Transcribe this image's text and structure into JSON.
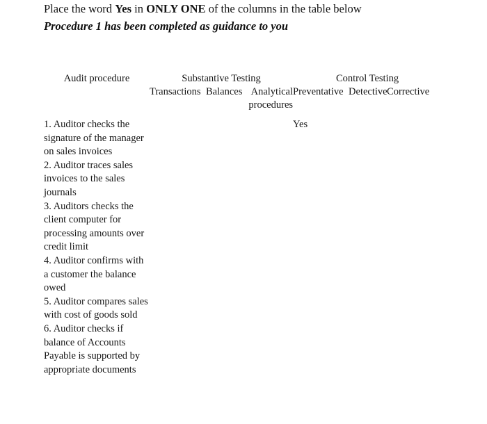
{
  "instructions": {
    "line1_pre": "Place the word ",
    "line1_bold1": "Yes",
    "line1_mid": " in ",
    "line1_bold2": "ONLY ONE",
    "line1_post": " of the columns in the table below",
    "line2": "Procedure 1 has been completed as guidance to you"
  },
  "table": {
    "group_headers": {
      "audit_procedure": "Audit procedure",
      "substantive_testing": "Substantive Testing",
      "control_testing": "Control Testing"
    },
    "sub_headers": {
      "transactions": "Transactions",
      "balances": "Balances",
      "analytical": "Analytical procedures",
      "preventative": "Preventative",
      "detective": "Detective",
      "corrective": "Corrective"
    },
    "rows": [
      {
        "procedure": "1. Auditor checks the signature of the manager on sales invoices",
        "transactions": "",
        "balances": "",
        "analytical": "",
        "preventative": "Yes",
        "detective": "",
        "corrective": ""
      },
      {
        "procedure": "2. Auditor traces sales invoices to the sales journals",
        "transactions": "",
        "balances": "",
        "analytical": "",
        "preventative": "",
        "detective": "",
        "corrective": ""
      },
      {
        "procedure": "3. Auditors checks the client computer for processing amounts over credit limit",
        "transactions": "",
        "balances": "",
        "analytical": "",
        "preventative": "",
        "detective": "",
        "corrective": ""
      },
      {
        "procedure": "4. Auditor confirms with a customer the balance owed",
        "transactions": "",
        "balances": "",
        "analytical": "",
        "preventative": "",
        "detective": "",
        "corrective": ""
      },
      {
        "procedure": "5. Auditor compares sales with cost of goods sold",
        "transactions": "",
        "balances": "",
        "analytical": "",
        "preventative": "",
        "detective": "",
        "corrective": ""
      },
      {
        "procedure": "6. Auditor checks if balance of Accounts Payable is supported by appropriate documents",
        "transactions": "",
        "balances": "",
        "analytical": "",
        "preventative": "",
        "detective": "",
        "corrective": ""
      }
    ]
  },
  "colors": {
    "page_background": "#ffffff",
    "text": "#161616"
  }
}
